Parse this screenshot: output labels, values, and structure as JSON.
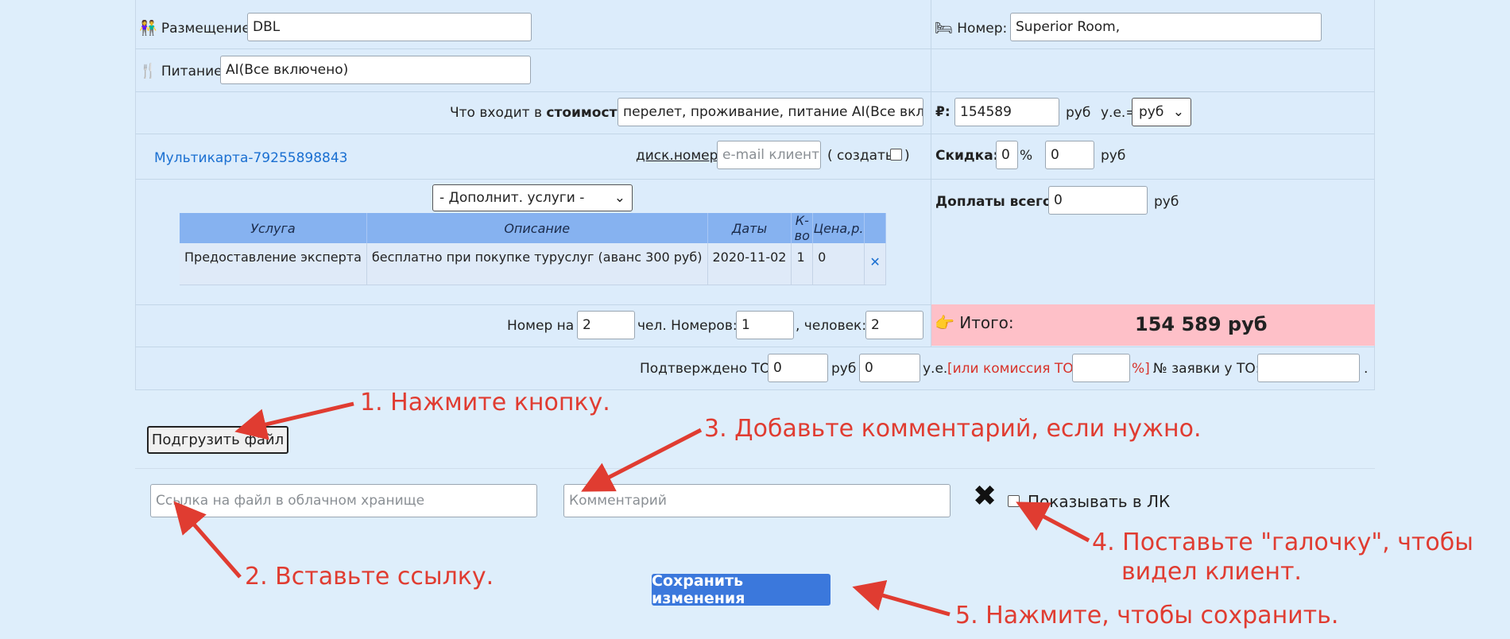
{
  "placement": {
    "label": "Размещение:",
    "value": "DBL"
  },
  "room": {
    "label": "Номер:",
    "value": "Superior Room,"
  },
  "meals": {
    "label": "Питание:",
    "value": "AI(Все включено)"
  },
  "cost_includes": {
    "label_prefix": "Что входит в",
    "label_bold": "стоимость",
    "label_suffix": ":",
    "value": "перелет, проживание, питание AI(Все включе"
  },
  "price": {
    "currency_symbol": "₽:",
    "value": "154589",
    "unit": "руб",
    "ue_label": "у.е.=",
    "ue_select": "руб"
  },
  "multicard": {
    "label": "Мультикарта-79255898843"
  },
  "disc": {
    "label": "диск.номер",
    "email_placeholder": "e-mail клиента",
    "create_label": "( создать",
    "create_suffix": ")"
  },
  "discount": {
    "label": "Скидка:",
    "percent": "0",
    "percent_sign": "%",
    "amount": "0",
    "unit": "руб"
  },
  "extra_services": {
    "select_label": "- Дополнит. услуги -",
    "columns": [
      "Услуга",
      "Описание",
      "Даты",
      "К-во",
      "Цена,р."
    ],
    "rows": [
      {
        "service": "Предоставление эксперта",
        "description": "бесплатно при покупке туруслуг (аванс 300 руб)",
        "dates": "2020-11-02",
        "qty": "1",
        "price": "0"
      }
    ]
  },
  "surcharges": {
    "label": "Доплаты всего:",
    "value": "0",
    "unit": "руб"
  },
  "occupancy": {
    "room_for_label": "Номер на",
    "room_for": "2",
    "people_label": "чел. Номеров:",
    "rooms": "1",
    "persons_label": ", человек:",
    "persons": "2"
  },
  "total": {
    "label": "Итого:",
    "value": "154 589 руб"
  },
  "confirmed": {
    "label": "Подтверждено ТО:",
    "rub_value": "0",
    "rub_unit": "руб",
    "ue_value": "0",
    "ue_unit": "у.е.",
    "commission_label": "[или комиссия ТО :",
    "commission_value": "",
    "commission_suffix": "%]",
    "order_label": "№ заявки у ТО:",
    "order_value": "",
    "end": "."
  },
  "upload": {
    "button": "Подгрузить файл",
    "link_placeholder": "Ссылка на файл в облачном хранище",
    "comment_placeholder": "Комментарий",
    "show_label": "Показывать в ЛК"
  },
  "save_button": "Сохранить изменения",
  "annotations": {
    "step1": "1. Нажмите кнопку.",
    "step2": "2. Вставьте ссылку.",
    "step3": "3. Добавьте комментарий, если нужно.",
    "step4_line1": "4. Поставьте \"галочку\", чтобы",
    "step4_line2": "видел клиент.",
    "step5": "5. Нажмите, чтобы сохранить."
  },
  "colors": {
    "annotation": "#e03c31",
    "save": "#3b78dc",
    "total_bg": "#fec0c8",
    "table_head": "#86b2f0",
    "link": "#1a6fd1"
  }
}
